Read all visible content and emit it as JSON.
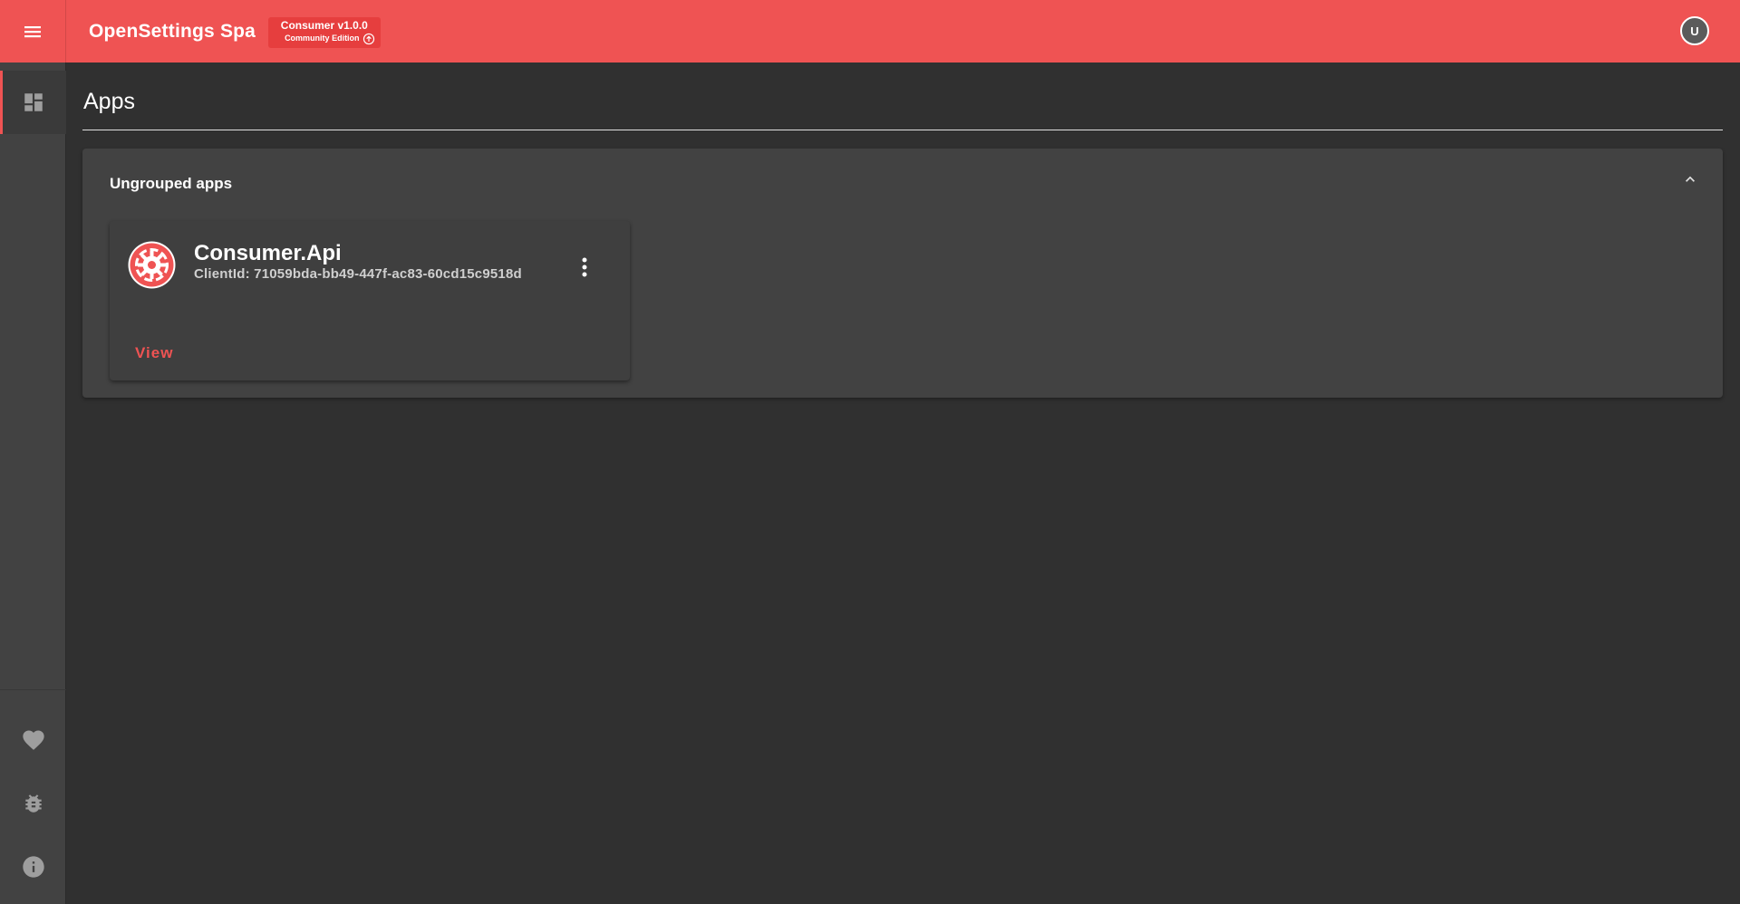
{
  "header": {
    "title": "OpenSettings Spa",
    "version_label": "Consumer v1.0.0",
    "edition_label": "Community Edition",
    "user_initial": "U"
  },
  "sidebar": {
    "items": [
      {
        "name": "dashboard",
        "icon": "dashboard-icon",
        "active": true
      }
    ],
    "bottom_items": [
      {
        "name": "favorites",
        "icon": "heart-icon"
      },
      {
        "name": "bug-report",
        "icon": "bug-icon"
      },
      {
        "name": "about",
        "icon": "info-icon"
      }
    ]
  },
  "main": {
    "page_title": "Apps",
    "group": {
      "title": "Ungrouped apps",
      "apps": [
        {
          "name": "Consumer.Api",
          "client_id": "ClientId: 71059bda-bb49-447f-ac83-60cd15c9518d",
          "view_label": "View"
        }
      ]
    }
  },
  "colors": {
    "accent": "#ef5353",
    "background": "#303030",
    "surface": "#424242",
    "sidebar": "#424242"
  }
}
